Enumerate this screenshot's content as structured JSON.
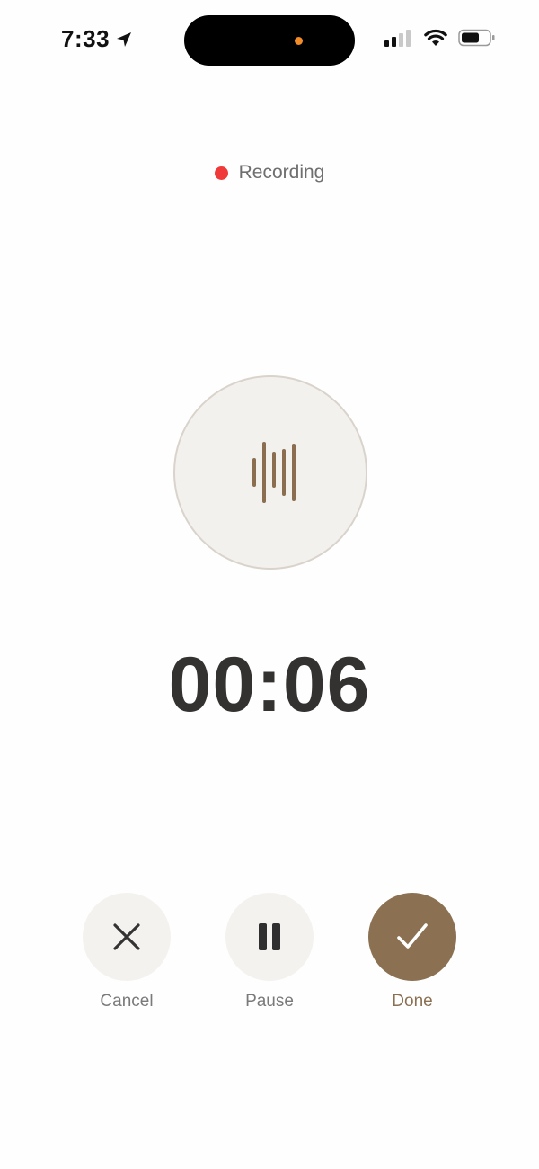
{
  "status_bar": {
    "time": "7:33",
    "island_dot_color": "#f28c28"
  },
  "recording": {
    "label": "Recording",
    "dot_color": "#f03a3a"
  },
  "timer": {
    "value": "00:06"
  },
  "controls": {
    "cancel_label": "Cancel",
    "pause_label": "Pause",
    "done_label": "Done"
  },
  "colors": {
    "accent": "#8b7152",
    "accent_label": "#8b7152",
    "wave": "#8b6d4f"
  },
  "icons": {
    "status": [
      "location-arrow-icon",
      "cellular-signal-icon",
      "wifi-icon",
      "battery-icon"
    ],
    "center": "waveform-icon",
    "controls": [
      "close-icon",
      "pause-icon",
      "checkmark-icon"
    ]
  }
}
